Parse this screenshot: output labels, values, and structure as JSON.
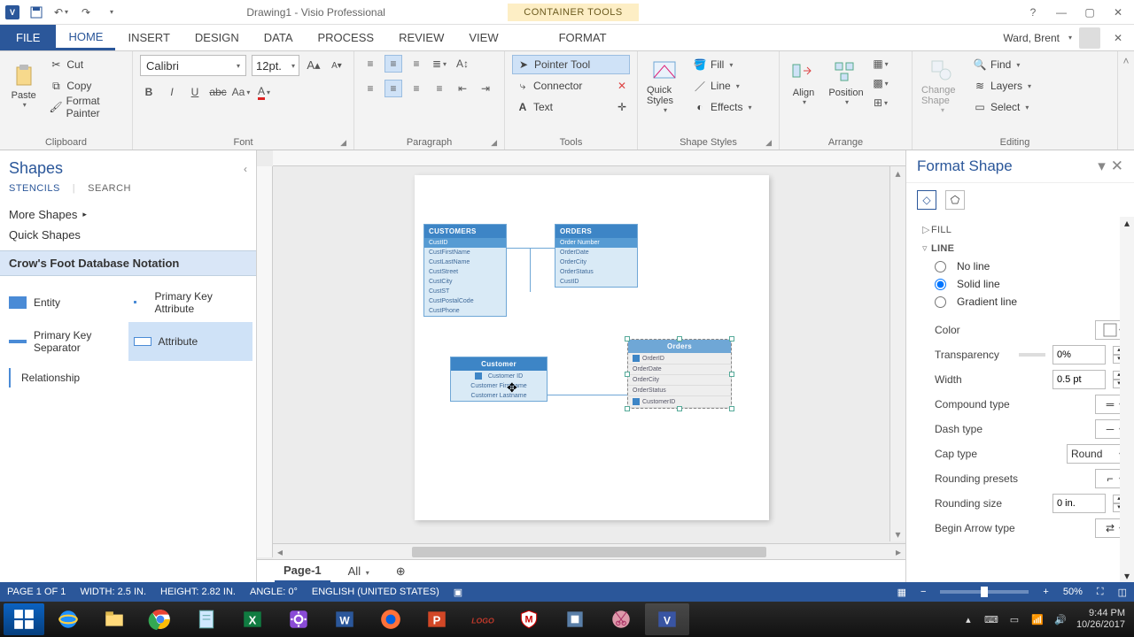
{
  "title": "Drawing1 - Visio Professional",
  "context_tab": "CONTAINER TOOLS",
  "user": "Ward, Brent",
  "tabs": {
    "file": "FILE",
    "home": "HOME",
    "insert": "INSERT",
    "design": "DESIGN",
    "data": "DATA",
    "process": "PROCESS",
    "review": "REVIEW",
    "view": "VIEW",
    "format": "FORMAT"
  },
  "ribbon": {
    "clipboard": {
      "paste": "Paste",
      "cut": "Cut",
      "copy": "Copy",
      "fmtpainter": "Format Painter",
      "label": "Clipboard"
    },
    "font": {
      "name": "Calibri",
      "size": "12pt.",
      "label": "Font"
    },
    "paragraph": {
      "label": "Paragraph"
    },
    "tools": {
      "pointer": "Pointer Tool",
      "connector": "Connector",
      "text": "Text",
      "label": "Tools"
    },
    "shapestyles": {
      "quick": "Quick Styles",
      "fill": "Fill",
      "line": "Line",
      "effects": "Effects",
      "label": "Shape Styles"
    },
    "arrange": {
      "align": "Align",
      "position": "Position",
      "label": "Arrange"
    },
    "editing": {
      "change": "Change Shape",
      "find": "Find",
      "layers": "Layers",
      "select": "Select",
      "label": "Editing"
    }
  },
  "shapes": {
    "title": "Shapes",
    "stencils_tab": "STENCILS",
    "search_tab": "SEARCH",
    "more": "More Shapes",
    "quick": "Quick Shapes",
    "stencil": "Crow's Foot Database Notation",
    "items": {
      "entity": "Entity",
      "pka": "Primary Key Attribute",
      "pks": "Primary Key Separator",
      "attr": "Attribute",
      "rel": "Relationship"
    }
  },
  "canvas": {
    "e1": {
      "title": "CUSTOMERS",
      "pk": "CustID",
      "rows": [
        "CustFirstName",
        "CustLastName",
        "CustStreet",
        "CustCity",
        "CustST",
        "CustPostalCode",
        "CustPhone"
      ]
    },
    "e2": {
      "title": "ORDERS",
      "pk": "Order Number",
      "rows": [
        "OrderDate",
        "OrderCity",
        "OrderStatus",
        "CustID"
      ]
    },
    "e3": {
      "title": "Customer",
      "rows": [
        "Customer ID",
        "Customer Firstname",
        "Customer Lastname"
      ]
    },
    "e4": {
      "title": "Orders",
      "rows": [
        "OrderID",
        "OrderDate",
        "OrderCity",
        "OrderStatus",
        "CustomerID"
      ]
    }
  },
  "pagetabs": {
    "p1": "Page-1",
    "all": "All"
  },
  "fmt": {
    "title": "Format Shape",
    "fill": "FILL",
    "line": "LINE",
    "noline": "No line",
    "solid": "Solid line",
    "grad": "Gradient line",
    "color": "Color",
    "transp": "Transparency",
    "transp_v": "0%",
    "width": "Width",
    "width_v": "0.5 pt",
    "compound": "Compound type",
    "dash": "Dash type",
    "cap": "Cap type",
    "cap_v": "Round",
    "roundp": "Rounding presets",
    "rounds": "Rounding size",
    "rounds_v": "0 in.",
    "barrow": "Begin Arrow type"
  },
  "status": {
    "page": "PAGE 1 OF 1",
    "width": "WIDTH: 2.5 IN.",
    "height": "HEIGHT: 2.82 IN.",
    "angle": "ANGLE: 0°",
    "lang": "ENGLISH (UNITED STATES)",
    "zoom": "50%"
  },
  "clock": {
    "time": "9:44 PM",
    "date": "10/26/2017"
  }
}
